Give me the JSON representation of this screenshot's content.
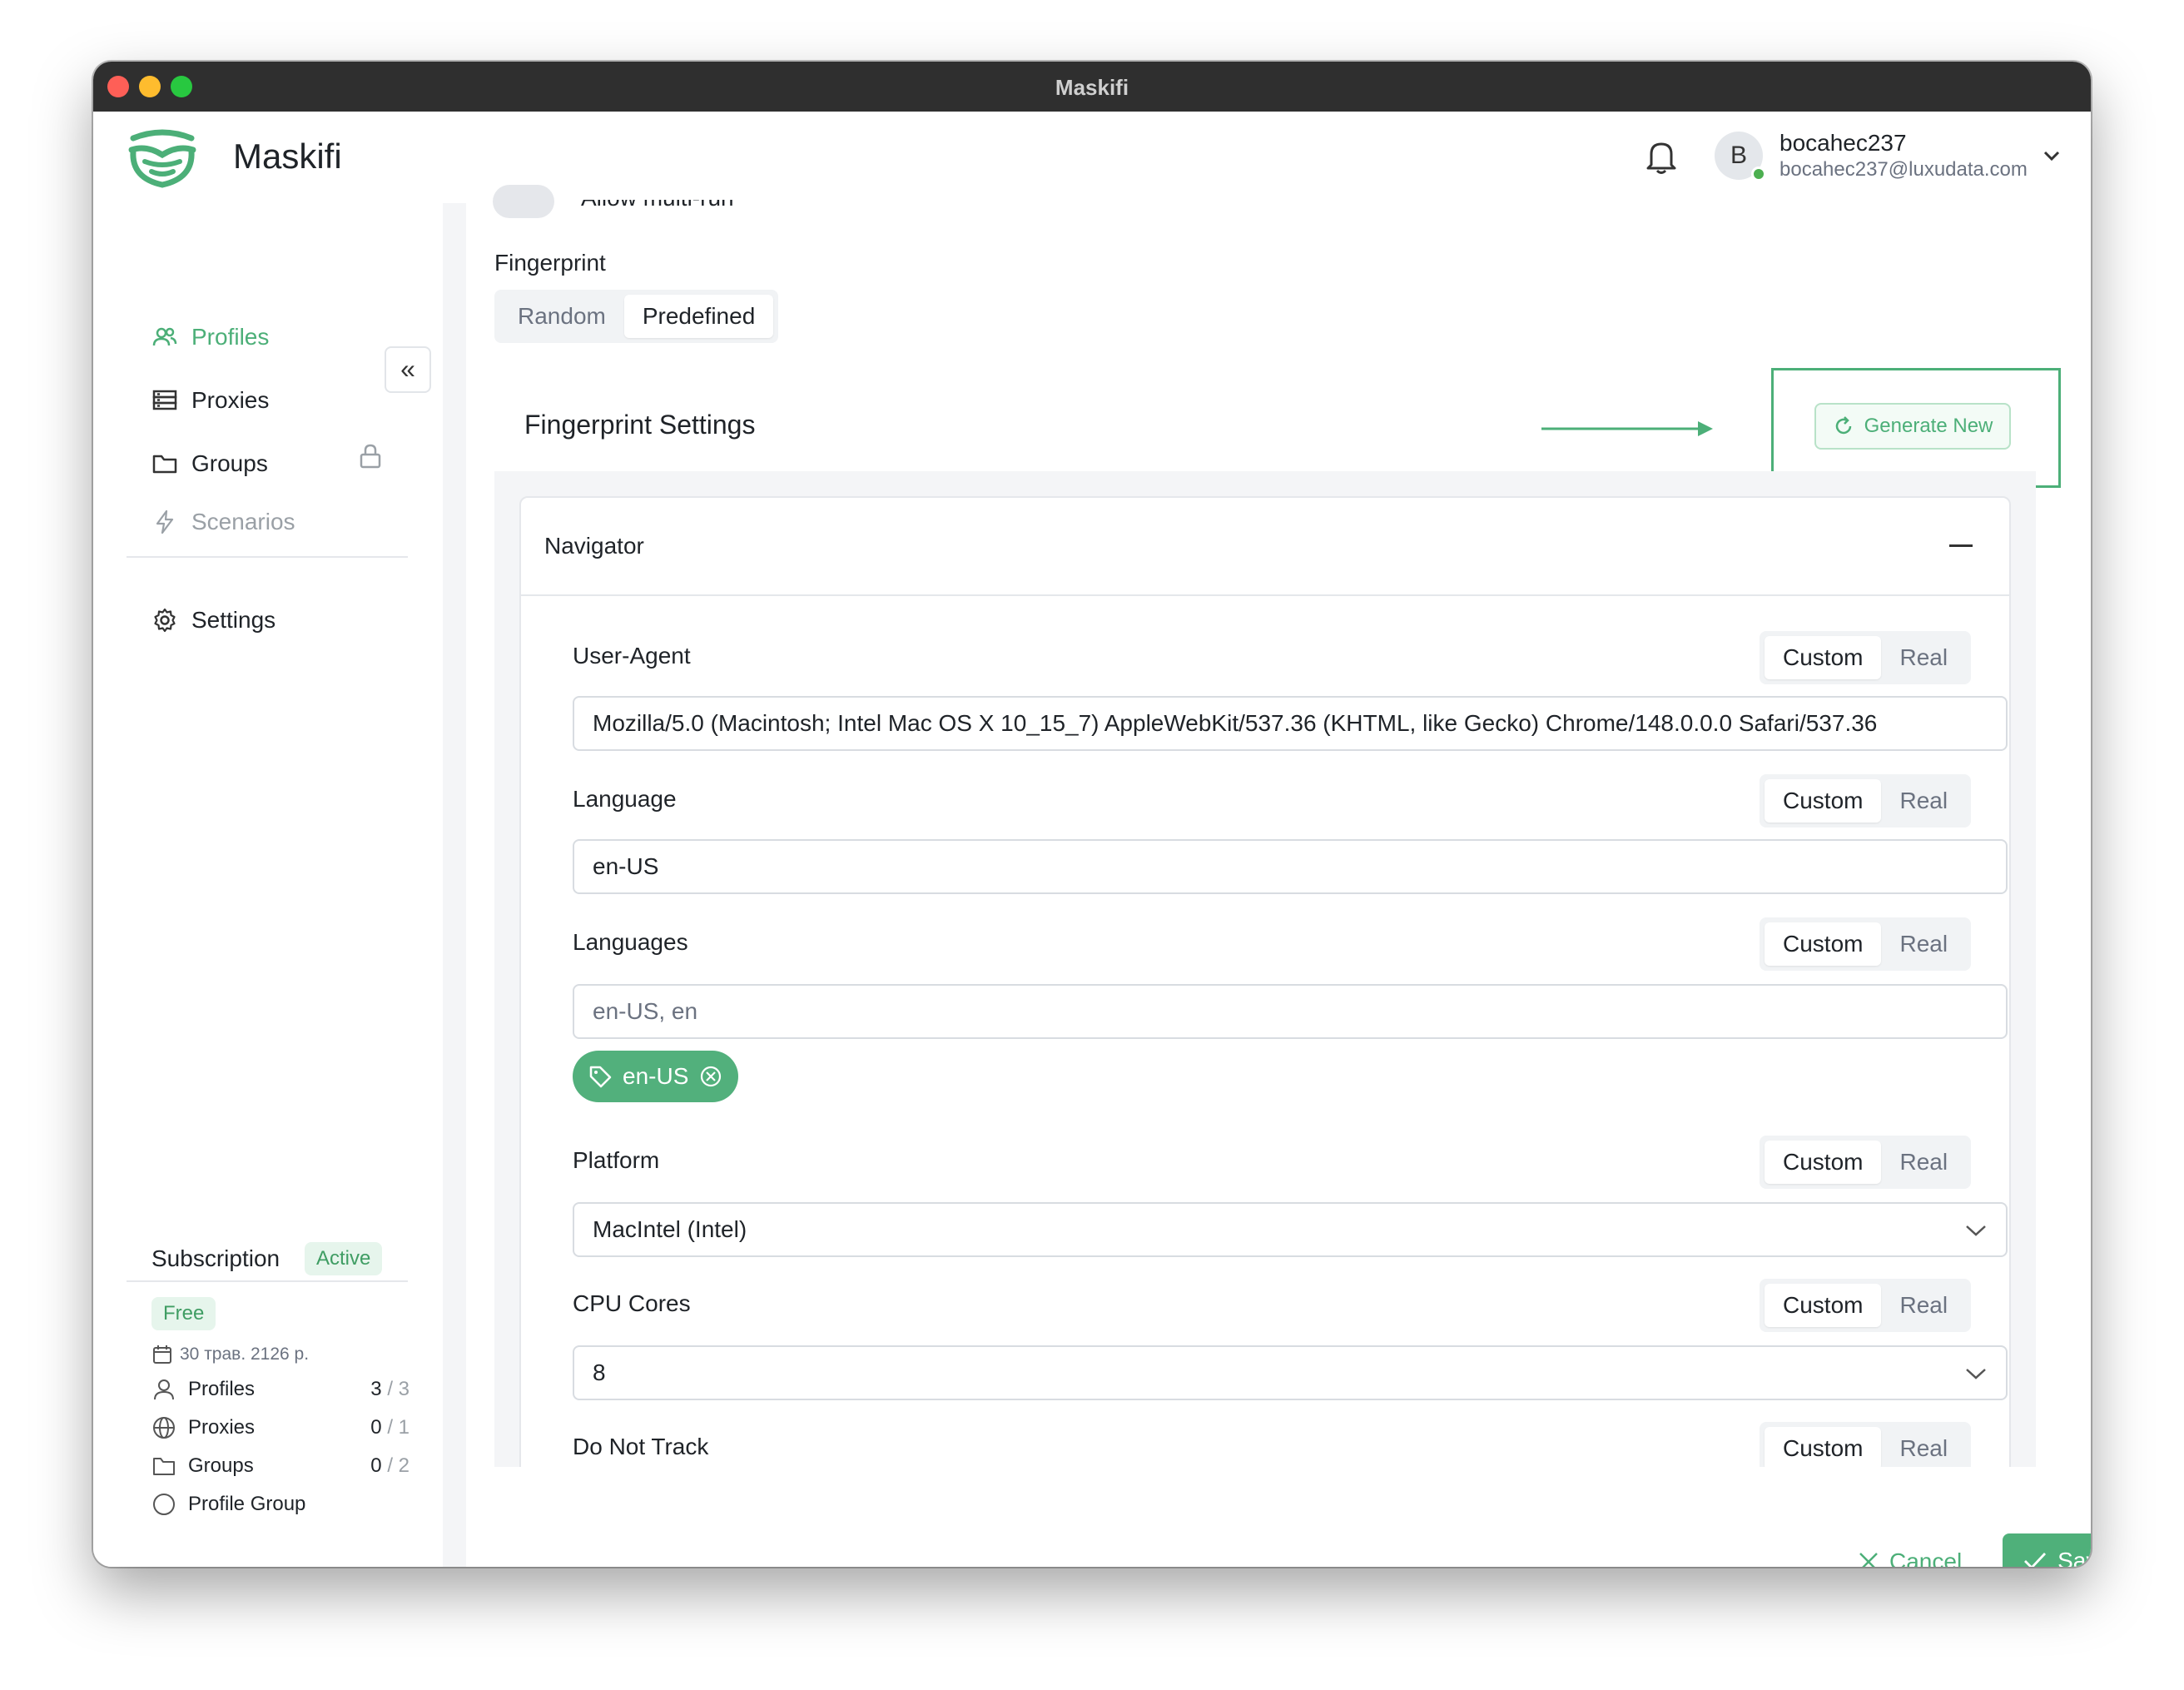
{
  "window": {
    "title": "Maskifi"
  },
  "app": {
    "name": "Maskifi",
    "brand_color": "#4caf78"
  },
  "user": {
    "initial": "B",
    "name": "bocahec237",
    "email": "bocahec237@luxudata.com",
    "status_color": "#4caf50"
  },
  "sidebar": {
    "collapse_icon": "«",
    "items": [
      {
        "label": "Profiles",
        "icon": "users-icon",
        "active": true
      },
      {
        "label": "Proxies",
        "icon": "server-icon"
      },
      {
        "label": "Groups",
        "icon": "folder-icon"
      },
      {
        "label": "Scenarios",
        "icon": "bolt-icon",
        "locked": true
      },
      {
        "label": "Settings",
        "icon": "gear-icon"
      }
    ],
    "subscription": {
      "title": "Subscription",
      "status": "Active",
      "plan": "Free",
      "expires": "30 трав. 2126 р.",
      "stats": [
        {
          "label": "Profiles",
          "used": "3",
          "limit": "/ 3",
          "icon": "user-icon"
        },
        {
          "label": "Proxies",
          "used": "0",
          "limit": "/ 1",
          "icon": "globe-icon"
        },
        {
          "label": "Groups",
          "used": "0",
          "limit": "/ 2",
          "icon": "folder-icon"
        },
        {
          "label": "Profile Group",
          "icon": "circle-icon"
        }
      ]
    }
  },
  "main": {
    "toggle_label": "Allow multi-run",
    "fingerprint": {
      "label": "Fingerprint",
      "options": [
        "Random",
        "Predefined"
      ],
      "selected": "Predefined"
    },
    "settings_title": "Fingerprint Settings",
    "generate_label": "Generate New",
    "navigator": {
      "title": "Navigator",
      "mode_options": [
        "Custom",
        "Real"
      ],
      "fields": [
        {
          "label": "User-Agent",
          "value": "Mozilla/5.0 (Macintosh; Intel Mac OS X 10_15_7) AppleWebKit/537.36 (KHTML, like Gecko) Chrome/148.0.0.0 Safari/537.36",
          "mode": "Custom"
        },
        {
          "label": "Language",
          "value": "en-US",
          "mode": "Custom"
        },
        {
          "label": "Languages",
          "placeholder": "en-US, en",
          "tags": [
            "en-US"
          ],
          "mode": "Custom"
        },
        {
          "label": "Platform",
          "value": "MacIntel (Intel)",
          "mode": "Custom",
          "type": "select"
        },
        {
          "label": "CPU Cores",
          "value": "8",
          "mode": "Custom",
          "type": "select"
        },
        {
          "label": "Do Not Track",
          "mode": "Custom"
        }
      ]
    },
    "cancel_label": "Cancel",
    "save_label": "Save"
  }
}
